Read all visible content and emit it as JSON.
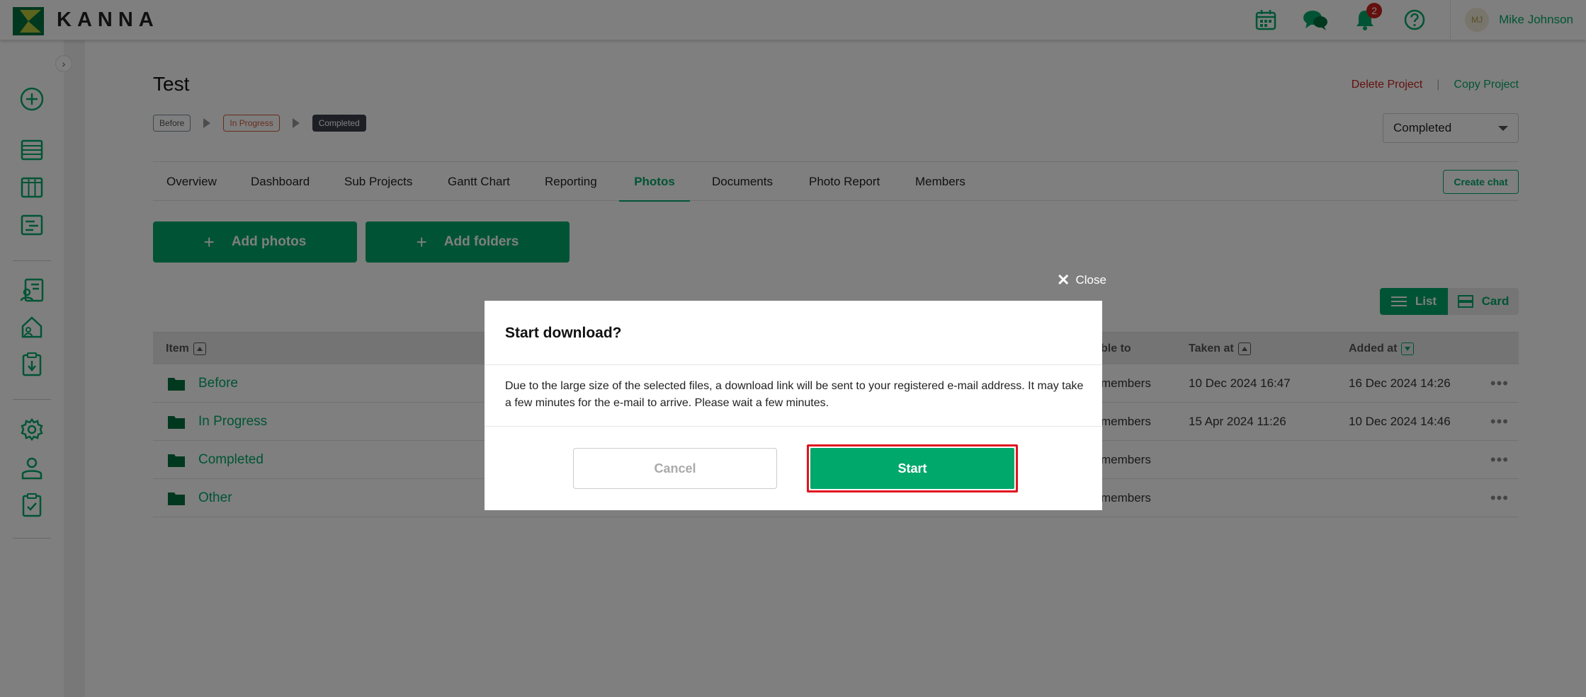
{
  "app": {
    "brand": "KANNA",
    "accent_color": "#00a86b",
    "danger_color": "#c8201d"
  },
  "topbar": {
    "icons": [
      "calendar-icon",
      "chat-icon",
      "bell-icon",
      "help-icon"
    ],
    "notification_count": "2",
    "user": {
      "initials": "MJ",
      "name": "Mike Johnson"
    }
  },
  "sidebar": {
    "collapse_label": "›",
    "icons": [
      "add-circle-icon",
      "list-icon",
      "board-icon",
      "schedule-icon",
      "client-icon",
      "property-icon",
      "download-report-icon",
      "settings-icon",
      "user-icon",
      "checklist-icon"
    ]
  },
  "project": {
    "title": "Test",
    "delete_label": "Delete Project",
    "link_separator": "|",
    "copy_label": "Copy Project",
    "steps": [
      "Before",
      "In Progress",
      "Completed"
    ],
    "status_value": "Completed"
  },
  "tabs": [
    "Overview",
    "Dashboard",
    "Sub Projects",
    "Gantt Chart",
    "Reporting",
    "Photos",
    "Documents",
    "Photo Report",
    "Members"
  ],
  "active_tab": "Photos",
  "create_chat_label": "Create chat",
  "actions": {
    "add_photos": "Add photos",
    "add_folders": "Add folders",
    "plus": "+"
  },
  "view_toggle": {
    "list": "List",
    "card": "Card"
  },
  "table": {
    "headers": {
      "item": "Item",
      "visible_to": "ble to",
      "taken_at": "Taken at",
      "added_at": "Added at"
    },
    "rows": [
      {
        "name": "Before",
        "visible_to": "members",
        "taken_at": "10 Dec 2024 16:47",
        "added_at": "16 Dec 2024 14:26"
      },
      {
        "name": "In Progress",
        "visible_to": "members",
        "taken_at": "15 Apr 2024 11:26",
        "added_at": "10 Dec 2024 14:46"
      },
      {
        "name": "Completed",
        "visible_to": "members",
        "taken_at": "",
        "added_at": ""
      },
      {
        "name": "Other",
        "visible_to": "members",
        "taken_at": "",
        "added_at": ""
      }
    ],
    "more_label": "•••"
  },
  "modal": {
    "close_label": "Close",
    "close_glyph": "✕",
    "title": "Start download?",
    "body": "Due to the large size of the selected files, a download link will be sent to your registered e-mail address. It may take a few minutes for the e-mail to arrive. Please wait a few minutes.",
    "cancel_label": "Cancel",
    "start_label": "Start",
    "highlight_color": "#e0141e"
  }
}
